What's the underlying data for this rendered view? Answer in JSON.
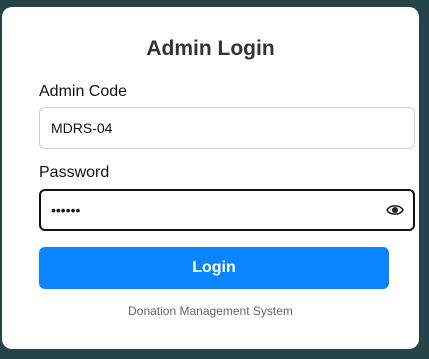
{
  "login": {
    "title": "Admin Login",
    "code_label": "Admin Code",
    "code_value": "MDRS-04",
    "password_label": "Password",
    "password_value": "••••••",
    "toggle_icon": "eye-icon",
    "button_label": "Login",
    "footer": "Donation Management System"
  },
  "colors": {
    "background": "#27434a",
    "card": "#ffffff",
    "accent": "#0b84ff",
    "text": "#333333",
    "muted": "#666666"
  }
}
